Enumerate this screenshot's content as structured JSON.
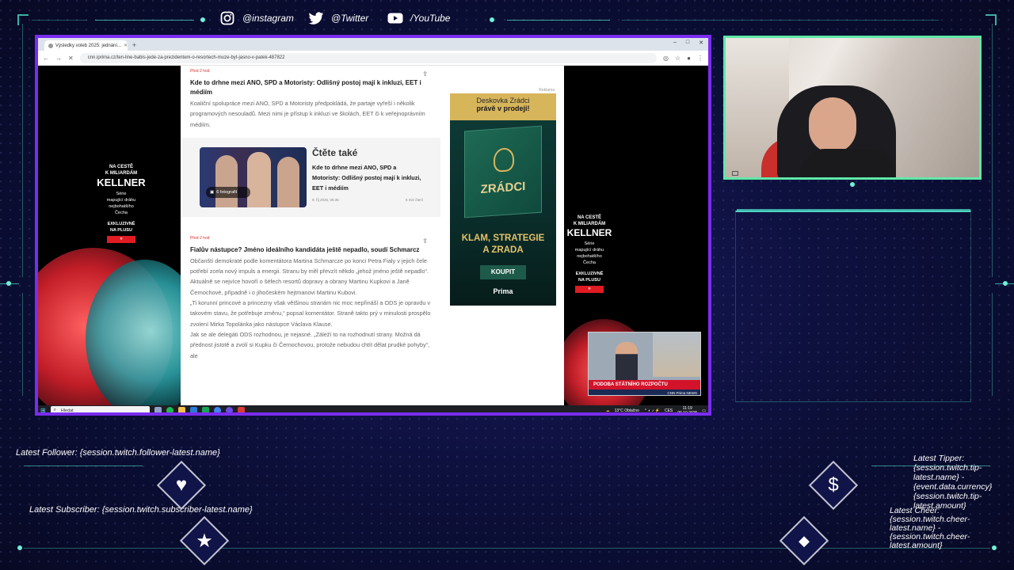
{
  "overlay": {
    "social": {
      "instagram": "@instagram",
      "twitter": "@Twitter",
      "youtube": "/YouTube"
    },
    "alerts": {
      "latest_follower": "Latest Follower: {session.twitch.follower-latest.name}",
      "latest_subscriber": "Latest Subscriber: {session.twitch.subscriber-latest.name}",
      "latest_tipper": [
        "Latest Tipper:",
        "{session.twitch.tip-",
        "latest.name} -",
        "{event.data.currency}",
        "{session.twitch.tip-",
        "latest.amount}"
      ],
      "latest_cheer": [
        "Latest Cheer:",
        "{session.twitch.cheer-",
        "latest.name} -",
        "{session.twitch.cheer-",
        "latest.amount}"
      ]
    },
    "accent_color": "#4fd7c4",
    "frame_color": "#7a2cf0",
    "webcam_border_color": "#5fe8a8"
  },
  "browser": {
    "tab_title": "Výsledky voleb 2025: jednání...",
    "new_tab": "+",
    "url": "cnn.iprima.cz/ten-line-babis-jede-za-prezidentem-o-resortech-muze-byt-jasno-v-patek-487822",
    "window_controls": [
      "–",
      "□",
      "✕"
    ]
  },
  "article": {
    "item1": {
      "time": "Před 2 hod",
      "headline": "Kde to drhne mezi ANO, SPD a Motoristy: Odlišný postoj mají k inkluzi, EET i médiím",
      "body": "Koaliční spolupráce mezi ANO, SPD a Motoristy předpokládá, že partaje vyřeší i několik programových nesouladů. Mezi nimi je přístup k inkluzi ve školách, EET či k veřejnoprávním médiím."
    },
    "read_also": {
      "heading": "Čtěte také",
      "headline": "Kde to drhne mezi ANO, SPD a Motoristy: Odlišný postoj mají k inkluzi, EET i médiím",
      "photos": "6 fotografií",
      "date": "9. říj 2025, 05:35",
      "read_time": "6 min čtení"
    },
    "item2": {
      "time": "Před 2 hod",
      "headline": "Fialův nástupce? Jméno ideálního kandidáta ještě nepadlo, soudí Schmarcz",
      "body": [
        "Občanští demokraté podle komentátora Martina Schmarcze po konci Petra Fialy v jejich čele potřebí zcela nový impuls a energii. Stranu by měl převzít někdo „jehož jméno ještě nepadlo“. Aktuálně se nejvíce hovoří o šéfech resortů dopravy a obrany Martinu Kupkovi a Janě Černochové, případně i o jihočeském hejtmanovi Martinu Kubovi.",
        "„Ti korunní princové a princezny však většinou stranám nic moc nepřináší a ODS je opravdu v takovém stavu, že potřebuje změnu,“ popsal komentátor. Straně takto prý v minulosti prospělo zvolení Mirka Topolánka jako nástupce Václava Klause.",
        "Jak se ale delegáti ODS rozhodnou, je nejasné. „Záleží to na rozhodnutí strany. Možná dá přednost jistotě a zvolí si Kupku či Černochovou, protože nebudou chtít dělat prudké pohyby“, ale"
      ]
    }
  },
  "ads": {
    "kellner_left": {
      "lines": [
        "NA CESTĚ",
        "K MILIARDÁM"
      ],
      "brand": "KELLNER",
      "sub": [
        "Série",
        "mapující dráhu",
        "nejbohatšího",
        "Čecha"
      ],
      "promo": [
        "EXKLUZIVNĚ",
        "NA PLUSU"
      ],
      "button": "»"
    },
    "kellner_right": {
      "lines": [
        "NA CESTĚ",
        "K MILIARDÁM"
      ],
      "brand": "KELLNER",
      "sub": [
        "Série",
        "mapující dráhu",
        "nejbohatšího",
        "Čecha"
      ],
      "promo": [
        "EXKLUZIVNĚ",
        "NA PLUSU"
      ],
      "button": "»"
    },
    "zradci": {
      "label": "Reklama",
      "top_line1": "Deskovka Zrádci",
      "top_line2": "právě v prodeji!",
      "box_title": "ZRÁDCI",
      "slogan1": "KLAM, STRATEGIE",
      "slogan2": "A ZRADA",
      "cta": "KOUPIT",
      "brand": "Prima"
    },
    "tv_banner": "PODOBA STÁTNÍHO ROZPOČTU",
    "tv_logo": "CNN Prima NEWS"
  },
  "taskbar": {
    "search_placeholder": "Hledat",
    "weather": "13°C Oblačno",
    "lang": "CES",
    "time": "11:19",
    "date": "09.10.2025"
  }
}
